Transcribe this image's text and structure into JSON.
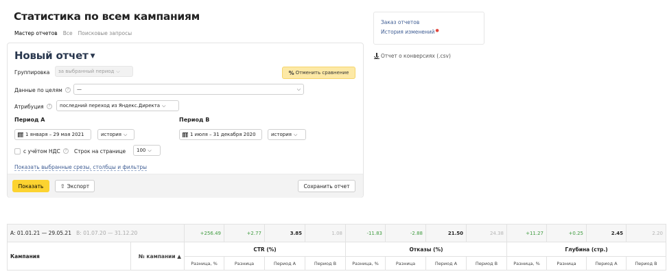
{
  "page": {
    "title": "Статистика по всем кампаниям",
    "tabs": [
      "Мастер отчетов",
      "Все",
      "Поисковые запросы"
    ]
  },
  "report": {
    "title": "Новый отчет",
    "grouping": {
      "label": "Группировка",
      "value": "за выбранный период"
    },
    "compare_button": "Отменить сравнение",
    "goals": {
      "label": "Данные по целям",
      "value": "—"
    },
    "attribution": {
      "label": "Атрибуция",
      "value": "последний переход из Яндекс.Директа"
    },
    "period_a": {
      "label": "Период А",
      "dates": "1 января – 29 мая 2021",
      "mode": "история"
    },
    "period_b": {
      "label": "Период В",
      "dates": "1 июля – 31 декабря 2020",
      "mode": "история"
    },
    "vat_label": "с учётом НДС",
    "rows_label": "Строк на странице",
    "rows_value": "100",
    "filters_link": "Показать выбранные срезы, столбцы и фильтры",
    "show_button": "Показать",
    "export_button": "Экспорт",
    "save_button": "Сохранить отчет"
  },
  "side": {
    "order_reports": "Заказ отчетов",
    "history": "История изменений",
    "conversions_csv": "Отчет о конверсиях (.csv)"
  },
  "table": {
    "period_a": "A: 01.01.21 — 29.05.21",
    "period_b": "B: 01.07.20 — 31.12.20",
    "summary": [
      "+256.49",
      "+2.77",
      "3.85",
      "1.08",
      "-11.83",
      "-2.88",
      "21.50",
      "24.38",
      "+11.27",
      "+0.25",
      "2.45",
      "2.20"
    ],
    "col_campaign": "Кампания",
    "col_campaign_no": "№ кампании ▲",
    "groups": [
      "CTR (%)",
      "Отказы (%)",
      "Глубина (стр.)"
    ],
    "subcols": [
      "Разница, %",
      "Разница",
      "Период A",
      "Период B"
    ]
  }
}
